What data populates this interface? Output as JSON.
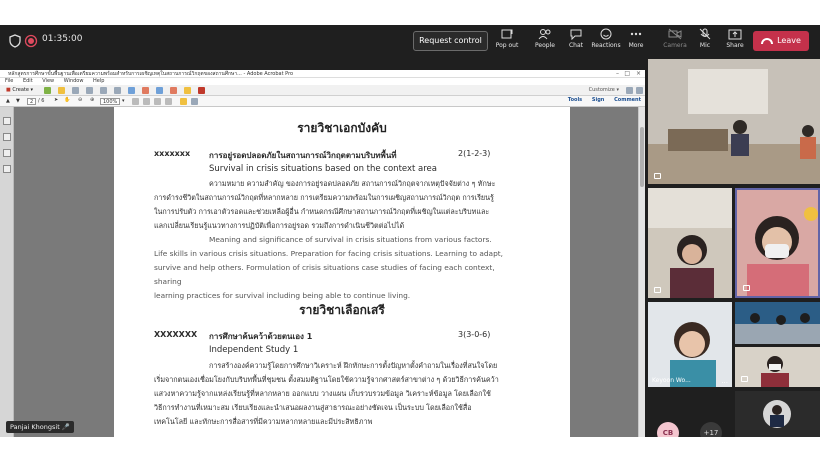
{
  "topbar": {
    "timer": "01:35:00",
    "request_control": "Request control",
    "tools": [
      {
        "label": "Pop out",
        "icon": "pop-out-icon"
      },
      {
        "label": "People",
        "icon": "people-icon"
      },
      {
        "label": "Chat",
        "icon": "chat-icon"
      },
      {
        "label": "Reactions",
        "icon": "reactions-icon"
      },
      {
        "label": "More",
        "icon": "more-icon"
      },
      {
        "label": "Camera",
        "icon": "camera-off-icon"
      },
      {
        "label": "Mic",
        "icon": "mic-off-icon"
      },
      {
        "label": "Share",
        "icon": "share-icon"
      }
    ],
    "leave": "Leave",
    "leave_color": "#c4314b"
  },
  "acrobat": {
    "title": "หลักสูตรการศึกษาขั้นพื้นฐานเพื่อเตรียมความพร้อมสำหรับการเผชิญเหตุในสถานการณ์วิกฤตของสถานศึกษา... - Adobe Acrobat Pro",
    "menu": [
      "File",
      "Edit",
      "View",
      "Window",
      "Help"
    ],
    "create": "Create",
    "customize": "Customize",
    "page_current": "2",
    "page_total": "/ 6",
    "zoom": "100%",
    "right_links": [
      "Tools",
      "Sign",
      "Comment"
    ]
  },
  "document": {
    "section1_title": "รายวิชาเอกบังคับ",
    "course1_code": "xxxxxxx",
    "course1_name_th": "การอยู่รอดปลอดภัยในสถานการณ์วิกฤตตามบริบทพื้นที่",
    "course1_credit": "2(1-2-3)",
    "course1_name_en": "Survival in crisis situations based on the context area",
    "course1_desc_th": [
      "ความหมาย ความสำคัญ ของการอยู่รอดปลอดภัย สถานการณ์วิกฤตจากเหตุปัจจัยต่าง ๆ ทักษะ",
      "การดำรงชีวิตในสถานการณ์วิกฤตที่หลากหลาย การเตรียมความพร้อมในการเผชิญสถานการณ์วิกฤต การเรียนรู้",
      "ในการปรับตัว การเอาตัวรอดและช่วยเหลือผู้อื่น กำหนดกรณีศึกษาสถานการณ์วิกฤตที่เผชิญในแต่ละบริบทและ",
      "แลกเปลี่ยนเรียนรู้แนวทางการปฏิบัติเพื่อการอยู่รอด รวมถึงการดำเนินชีวิตต่อไปได้"
    ],
    "course1_desc_en": [
      "Meaning and significance of survival in crisis situations from various factors.",
      "Life skills in various crisis situations. Preparation for facing crisis situations. Learning to adapt,",
      "survive and help others. Formulation of crisis situations case studies of facing each context, sharing",
      "learning practices for survival including being able to continue living."
    ],
    "section2_title": "รายวิชาเลือกเสรี",
    "course2_code": "XXXXXXX",
    "course2_name_th": "การศึกษาค้นคว้าด้วยตนเอง 1",
    "course2_credit": "3(3-0-6)",
    "course2_name_en": "Independent Study 1",
    "course2_desc_th": [
      "การสร้างองค์ความรู้โดยการศึกษาวิเคราะห์ ฝึกทักษะการตั้งปัญหาตั้งคำถามในเรื่องที่สนใจโดย",
      "เริ่มจากตนเองเชื่อมโยงกับบริบทพื้นที่ชุมชน ตั้งสมมติฐานโดยใช้ความรู้จากศาสตร์สาขาต่าง ๆ ด้วยวิธีการค้นคว้า",
      "แสวงหาความรู้จากแหล่งเรียนรู้ที่หลากหลาย ออกแบบ วางแผน เก็บรวบรวมข้อมูล วิเคราะห์ข้อมูล โดยเลือกใช้",
      "วิธีการทำงานที่เหมาะสม เรียบเรียงและนำเสนอผลงานสู่สาธารณะอย่างชัดเจน เป็นระบบ โดยเลือกใช้สื่อ",
      "เทคโนโลยี และทักษะการสื่อสารที่มีความหลากหลายและมีประสิทธิภาพ"
    ]
  },
  "participants": {
    "keyoon_name": "Keyoon Wo...",
    "more_dots": "...",
    "cb_initials": "CB",
    "extra_count": "+17",
    "speaker_name": "Panjai Khongsit"
  }
}
